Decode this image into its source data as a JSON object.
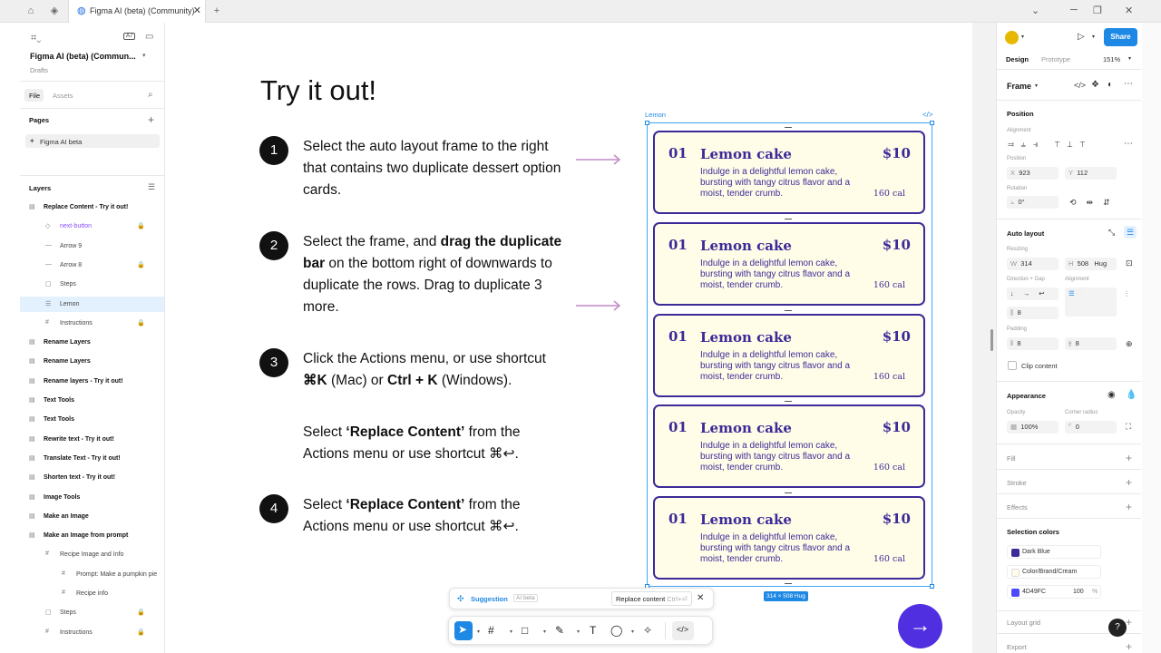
{
  "titlebar": {
    "tab_title": "Figma AI (beta) (Community)",
    "tab_close": "✕",
    "new_tab": "+"
  },
  "left_panel": {
    "file_name": "Figma AI (beta) (Commun...",
    "file_sub": "Drafts",
    "badge": "A7",
    "tabs": [
      "File",
      "Assets"
    ],
    "pages_label": "Pages",
    "page_name": "Figma AI beta",
    "layers_label": "Layers",
    "layers": [
      {
        "label": "Replace Content - Try it out!",
        "bold": true,
        "indent": 0
      },
      {
        "label": "next-button",
        "indent": 1,
        "purple": true,
        "lock": true
      },
      {
        "label": "Arrow 9",
        "indent": 1
      },
      {
        "label": "Arrow 8",
        "indent": 1,
        "lock": true
      },
      {
        "label": "Steps",
        "indent": 1
      },
      {
        "label": "Lemon",
        "indent": 1,
        "selected": true
      },
      {
        "label": "Instructions",
        "indent": 1,
        "lock": true
      },
      {
        "label": "Rename Layers",
        "bold": true,
        "indent": 0
      },
      {
        "label": "Rename Layers",
        "bold": true,
        "indent": 0
      },
      {
        "label": "Rename layers - Try it out!",
        "bold": true,
        "indent": 0
      },
      {
        "label": "Text Tools",
        "bold": true,
        "indent": 0
      },
      {
        "label": "Text Tools",
        "bold": true,
        "indent": 0
      },
      {
        "label": "Rewrite text - Try it out!",
        "bold": true,
        "indent": 0
      },
      {
        "label": "Translate Text - Try it out!",
        "bold": true,
        "indent": 0
      },
      {
        "label": "Shorten text - Try it out!",
        "bold": true,
        "indent": 0
      },
      {
        "label": "Image Tools",
        "bold": true,
        "indent": 0
      },
      {
        "label": "Make an Image",
        "bold": true,
        "indent": 0
      },
      {
        "label": "Make an Image from prompt",
        "bold": true,
        "indent": 0
      },
      {
        "label": "Recipe Image and Info",
        "indent": 1
      },
      {
        "label": "Prompt: Make a pumpkin pie",
        "indent": 2
      },
      {
        "label": "Recipe info",
        "indent": 2
      },
      {
        "label": "Steps",
        "indent": 1,
        "lock": true
      },
      {
        "label": "Instructions",
        "indent": 1,
        "lock": true
      }
    ]
  },
  "canvas": {
    "heading": "Try it out!",
    "steps": [
      {
        "num": "1",
        "html": "Select the auto layout frame to the right that contains two duplicate dessert option cards."
      },
      {
        "num": "2",
        "parts": [
          "Select the frame, and ",
          "drag the duplicate bar",
          " on the bottom right of downwards to duplicate the rows. Drag to duplicate 3 more."
        ]
      },
      {
        "num": "3",
        "parts": [
          "Click the Actions menu, or use shortcut ",
          "⌘K",
          " (Mac) or ",
          "Ctrl + K",
          " (Windows)."
        ],
        "sub_parts": [
          "Select ",
          "‘Replace Content’",
          " from the Actions menu  or use shortcut ⌘↩."
        ]
      },
      {
        "num": "4",
        "parts": [
          "Select ",
          "‘Replace Content’",
          " from the Actions menu  or use shortcut ⌘↩."
        ]
      }
    ],
    "frame_label": "Lemon",
    "frame_code": "</>",
    "size_badge": "314 × 508 Hug",
    "cards": [
      {
        "num": "01",
        "title": "Lemon cake",
        "price": "$10",
        "desc": "Indulge in a delightful lemon cake, bursting with tangy citrus flavor and a moist, tender crumb.",
        "cal": "160 cal"
      },
      {
        "num": "01",
        "title": "Lemon cake",
        "price": "$10",
        "desc": "Indulge in a delightful lemon cake, bursting with tangy citrus flavor and a moist, tender crumb.",
        "cal": "160 cal"
      },
      {
        "num": "01",
        "title": "Lemon cake",
        "price": "$10",
        "desc": "Indulge in a delightful lemon cake, bursting with tangy citrus flavor and a moist, tender crumb.",
        "cal": "160 cal"
      },
      {
        "num": "01",
        "title": "Lemon cake",
        "price": "$10",
        "desc": "Indulge in a delightful lemon cake, bursting with tangy citrus flavor and a moist, tender crumb.",
        "cal": "160 cal"
      },
      {
        "num": "01",
        "title": "Lemon cake",
        "price": "$10",
        "desc": "Indulge in a delightful lemon cake, bursting with tangy citrus flavor and a moist, tender crumb.",
        "cal": "160 cal"
      }
    ],
    "suggestion": {
      "label": "Suggestion",
      "beta": "AI beta",
      "action": "Replace content",
      "shortcut": "Ctrl+⏎",
      "close": "✕"
    },
    "next_arrow": "→"
  },
  "right_panel": {
    "share": "Share",
    "tabs": [
      "Design",
      "Prototype"
    ],
    "zoom": "151%",
    "frame_type": "Frame",
    "position_label": "Position",
    "alignment_label": "Alignment",
    "position_sub": "Position",
    "x_label": "X",
    "x": "923",
    "y_label": "Y",
    "y": "112",
    "rotation_label": "Rotation",
    "rotation": "0°",
    "autolayout_label": "Auto layout",
    "resizing_label": "Resizing",
    "w_label": "W",
    "w": "314",
    "h_label": "H",
    "h": "508",
    "h_mode": "Hug",
    "direction_label": "Direction + Gap",
    "align_label": "Alignment",
    "gap": "8",
    "padding_label": "Padding",
    "pad_h": "8",
    "pad_v": "8",
    "clip": "Clip content",
    "appearance_label": "Appearance",
    "opacity_label": "Opacity",
    "opacity": "100%",
    "radius_label": "Corner radius",
    "radius": "0",
    "fill": "Fill",
    "stroke": "Stroke",
    "effects": "Effects",
    "selection_colors": "Selection colors",
    "colors": [
      {
        "name": "Dark Blue",
        "hex": "#3c2a98"
      },
      {
        "name": "Color/Brand/Cream",
        "hex": "#fffde7"
      },
      {
        "name": "4D49FC",
        "hex": "#4d49fc",
        "pct": "100",
        "pct_unit": "%"
      }
    ],
    "layout_grid": "Layout grid",
    "export": "Export",
    "help": "?"
  }
}
